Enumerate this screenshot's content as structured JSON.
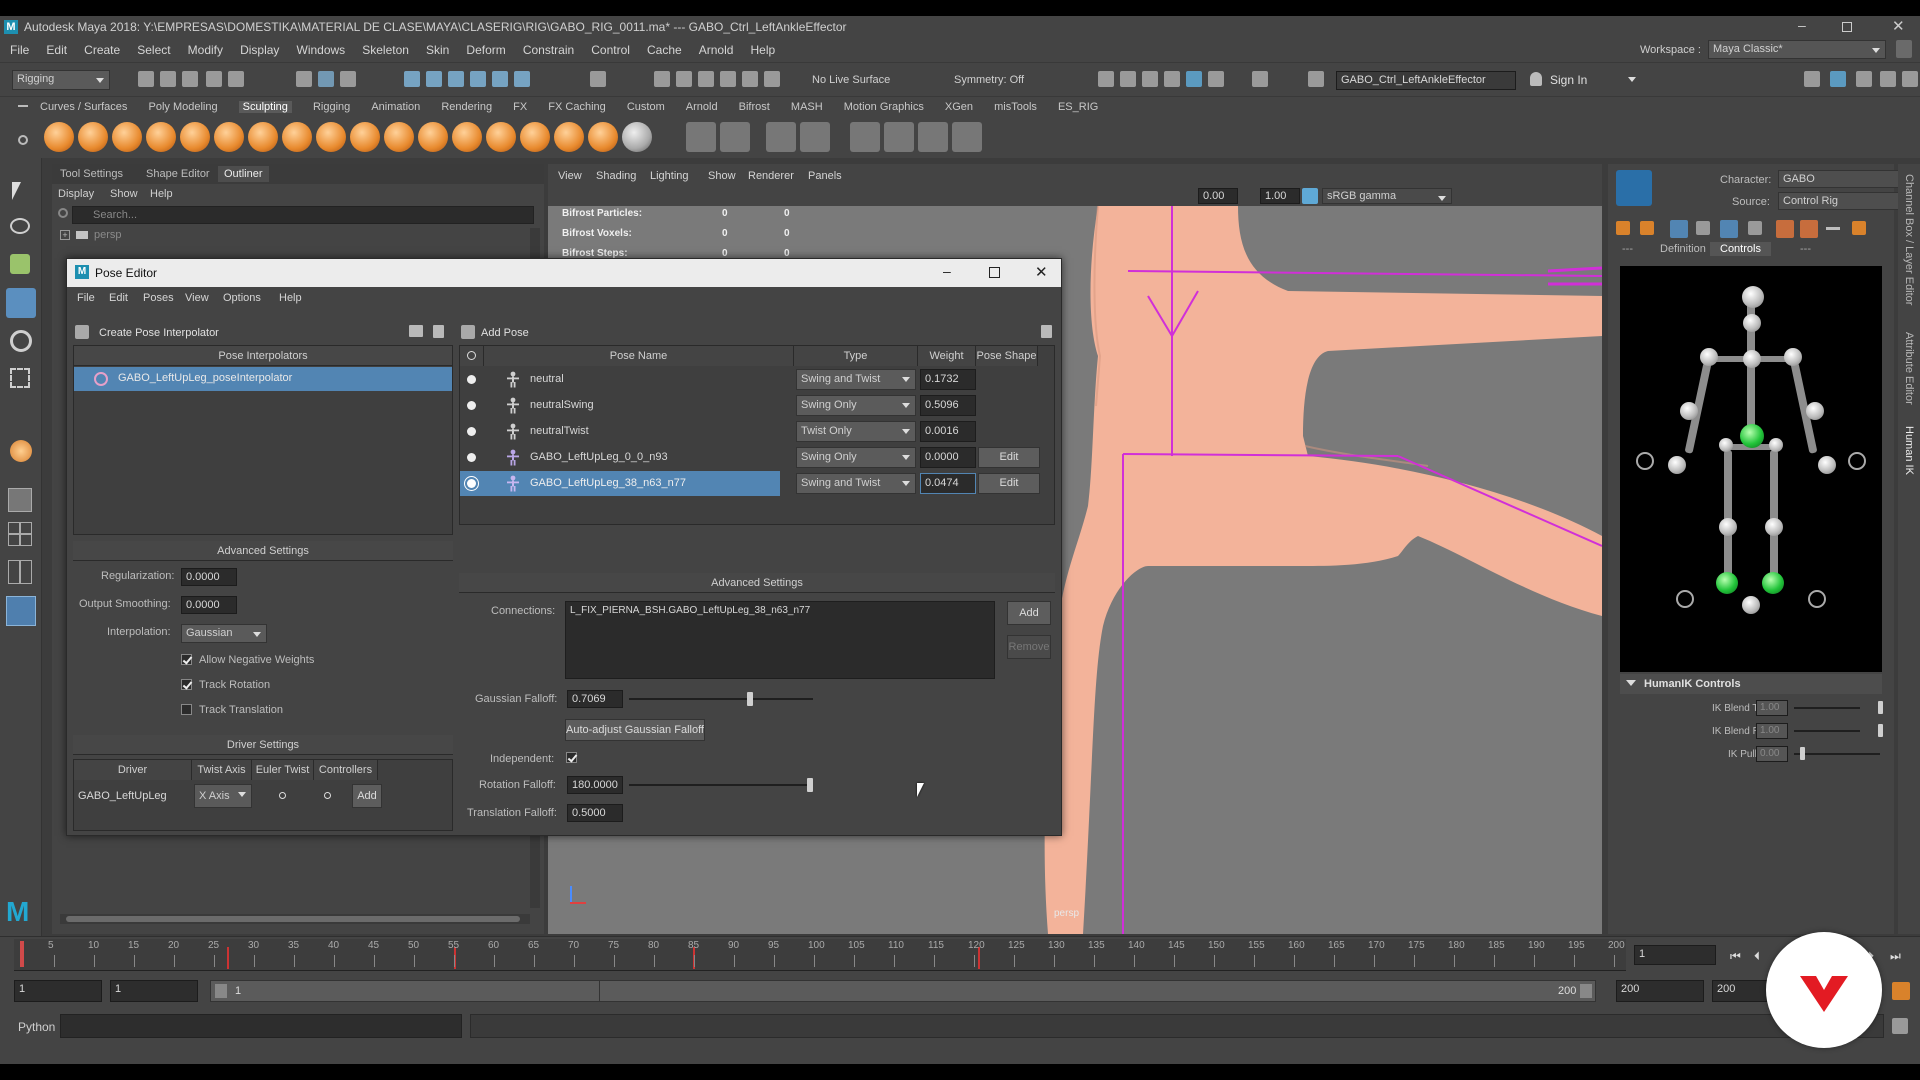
{
  "app": {
    "title_bar": "Autodesk Maya 2018: Y:\\EMPRESAS\\DOMESTIKA\\MATERIAL DE CLASE\\MAYA\\CLASERIG\\RIG\\GABO_RIG_0011.ma*   ---   GABO_Ctrl_LeftAnkleEffector",
    "menus": [
      "File",
      "Edit",
      "Create",
      "Select",
      "Modify",
      "Display",
      "Windows",
      "Skeleton",
      "Skin",
      "Deform",
      "Constrain",
      "Control",
      "Cache",
      "Arnold",
      "Help"
    ],
    "workspace_label": "Workspace :",
    "workspace_value": "Maya Classic*"
  },
  "status_line": {
    "menu_set": "Rigging",
    "live_surface": "No Live Surface",
    "symmetry": "Symmetry: Off",
    "selected_object": "GABO_Ctrl_LeftAnkleEffector",
    "sign_in": "Sign In"
  },
  "shelf": {
    "tabs": [
      "Curves / Surfaces",
      "Poly Modeling",
      "Sculpting",
      "Rigging",
      "Animation",
      "Rendering",
      "FX",
      "FX Caching",
      "Custom",
      "Arnold",
      "Bifrost",
      "MASH",
      "Motion Graphics",
      "XGen",
      "misTools",
      "ES_RIG"
    ],
    "active_tab": "Sculpting"
  },
  "left_panel": {
    "tabs": [
      "Tool Settings",
      "Shape Editor",
      "Outliner"
    ],
    "menus": [
      "Display",
      "Show",
      "Help"
    ],
    "search_placeholder": "Search...",
    "first_item": "persp"
  },
  "viewport": {
    "menus": [
      "View",
      "Shading",
      "Lighting",
      "Show",
      "Renderer",
      "Panels"
    ],
    "exposure": "0.00",
    "gamma": "1.00",
    "color_space": "sRGB gamma",
    "hud": [
      {
        "label": "Bifrost Particles:",
        "a": "0",
        "b": "0"
      },
      {
        "label": "Bifrost Voxels:",
        "a": "0",
        "b": "0"
      },
      {
        "label": "Bifrost Steps:",
        "a": "0",
        "b": "0"
      }
    ],
    "camera_label": "persp"
  },
  "pose_editor": {
    "title": "Pose Editor",
    "menus": [
      "File",
      "Edit",
      "Poses",
      "View",
      "Options",
      "Help"
    ],
    "create_interpolator": "Create Pose Interpolator",
    "interpolators_header": "Pose Interpolators",
    "interpolators": [
      "GABO_LeftUpLeg_poseInterpolator"
    ],
    "add_pose": "Add Pose",
    "columns": [
      "Pose Name",
      "Type",
      "Weight",
      "Pose Shape"
    ],
    "poses": [
      {
        "name": "neutral",
        "type": "Swing and Twist",
        "weight": "0.1732",
        "shape": ""
      },
      {
        "name": "neutralSwing",
        "type": "Swing Only",
        "weight": "0.5096",
        "shape": ""
      },
      {
        "name": "neutralTwist",
        "type": "Twist Only",
        "weight": "0.0016",
        "shape": ""
      },
      {
        "name": "GABO_LeftUpLeg_0_0_n93",
        "type": "Swing Only",
        "weight": "0.0000",
        "shape": "Edit"
      },
      {
        "name": "GABO_LeftUpLeg_38_n63_n77",
        "type": "Swing and Twist",
        "weight": "0.0474",
        "shape": "Edit"
      }
    ],
    "left_advanced": {
      "header": "Advanced Settings",
      "regularization_label": "Regularization:",
      "regularization": "0.0000",
      "output_smoothing_label": "Output Smoothing:",
      "output_smoothing": "0.0000",
      "interpolation_label": "Interpolation:",
      "interpolation": "Gaussian",
      "allow_negative": "Allow Negative Weights",
      "track_rotation": "Track Rotation",
      "track_translation": "Track Translation"
    },
    "driver_settings": {
      "header": "Driver Settings",
      "columns": [
        "Driver",
        "Twist Axis",
        "Euler Twist",
        "Controllers"
      ],
      "driver": "GABO_LeftUpLeg",
      "twist_axis": "X Axis",
      "add": "Add"
    },
    "right_advanced": {
      "header": "Advanced Settings",
      "connections_label": "Connections:",
      "connection": "L_FIX_PIERNA_BSH.GABO_LeftUpLeg_38_n63_n77",
      "add": "Add",
      "remove": "Remove",
      "gaussian_falloff_label": "Gaussian Falloff:",
      "gaussian_falloff": "0.7069",
      "gaussian_falloff_value": 0.7069,
      "auto_adjust": "Auto-adjust Gaussian Falloff",
      "independent_label": "Independent:",
      "rotation_falloff_label": "Rotation Falloff:",
      "rotation_falloff": "180.0000",
      "rotation_falloff_value": 180.0,
      "translation_falloff_label": "Translation Falloff:",
      "translation_falloff": "0.5000"
    }
  },
  "humanik": {
    "character_label": "Character:",
    "character": "GABO",
    "source_label": "Source:",
    "source": "Control Rig",
    "tabs": [
      "---",
      "Definition",
      "Controls",
      "---"
    ],
    "active_tab": "Controls",
    "controls_header": "HumanIK Controls",
    "blend_t_label": "IK Blend T",
    "blend_t": "1.00",
    "blend_r_label": "IK Blend R",
    "blend_r": "1.00",
    "pull_label": "IK Pull",
    "pull": "0.00"
  },
  "side_tabs": [
    "Channel Box / Layer Editor",
    "Attribute Editor",
    "Human IK"
  ],
  "timeline": {
    "ticks": [
      "5",
      "10",
      "15",
      "20",
      "25",
      "30",
      "35",
      "40",
      "45",
      "50",
      "55",
      "60",
      "65",
      "70",
      "75",
      "80",
      "85",
      "90",
      "95",
      "100",
      "105",
      "110",
      "115",
      "120",
      "125",
      "130",
      "135",
      "140",
      "145",
      "150",
      "155",
      "160",
      "165",
      "170",
      "175",
      "180",
      "185",
      "190",
      "195",
      "200"
    ],
    "current_frame": "1"
  },
  "range_slider": {
    "start": "1",
    "start_inner": "1",
    "range_start": "1",
    "range_end": "200",
    "end_inner": "200",
    "end": "200"
  },
  "command_line": {
    "language": "Python"
  }
}
